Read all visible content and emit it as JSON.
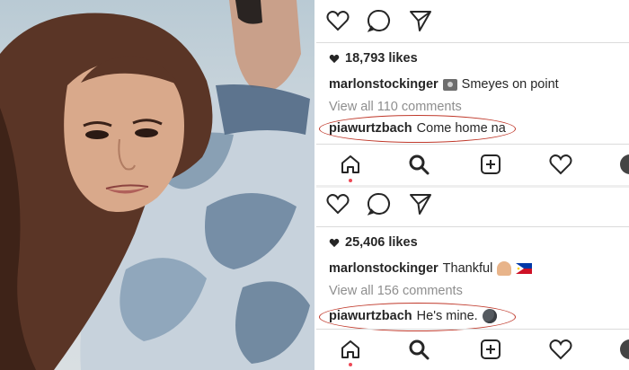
{
  "posts": [
    {
      "likes": "18,793 likes",
      "caption_user": "marlonstockinger",
      "caption_emoji": "camera-with-flash-emoji",
      "caption_text": "Smeyes on point",
      "view_all": "View all 110 comments",
      "comment_user": "piawurtzbach",
      "comment_text": "Come home na"
    },
    {
      "likes": "25,406 likes",
      "caption_user": "marlonstockinger",
      "caption_text": "Thankful",
      "caption_emojis": [
        "folded-hands-emoji",
        "philippines-flag-emoji"
      ],
      "view_all": "View all 156 comments",
      "comment_user": "piawurtzbach",
      "comment_text": "He's mine.",
      "comment_emoji": "new-moon-face-emoji"
    }
  ],
  "icons": {
    "post_actions": [
      "heart-icon",
      "comment-icon",
      "send-icon"
    ],
    "likes": "heart-icon",
    "nav": [
      "home-icon",
      "search-icon",
      "add-post-icon",
      "activity-heart-icon",
      "profile-avatar"
    ]
  },
  "colors": {
    "highlight_oval": "#c0392b",
    "notification_dot": "#ed4956",
    "text": "#262626",
    "muted": "#8e8e8e"
  }
}
